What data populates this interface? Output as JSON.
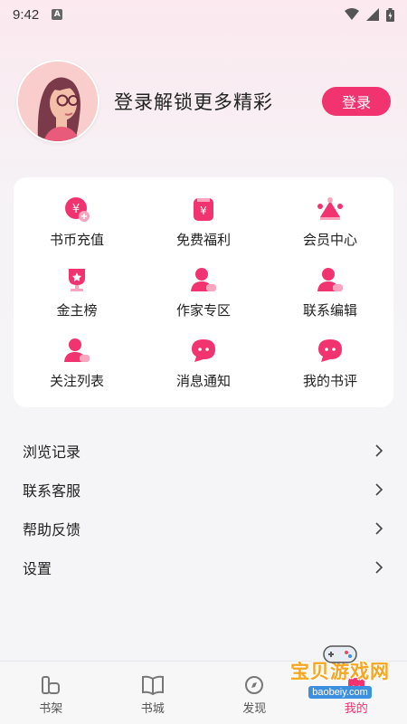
{
  "status_bar": {
    "time": "9:42",
    "notification_letter": "A"
  },
  "profile": {
    "login_prompt": "登录解锁更多精彩",
    "login_button": "登录"
  },
  "grid": [
    {
      "label": "书币充值",
      "icon": "coin-icon"
    },
    {
      "label": "免费福利",
      "icon": "gift-icon"
    },
    {
      "label": "会员中心",
      "icon": "crown-icon"
    },
    {
      "label": "金主榜",
      "icon": "trophy-icon"
    },
    {
      "label": "作家专区",
      "icon": "writer-icon"
    },
    {
      "label": "联系编辑",
      "icon": "editor-icon"
    },
    {
      "label": "关注列表",
      "icon": "follow-icon"
    },
    {
      "label": "消息通知",
      "icon": "message-icon"
    },
    {
      "label": "我的书评",
      "icon": "review-icon"
    }
  ],
  "menu": [
    {
      "label": "浏览记录"
    },
    {
      "label": "联系客服"
    },
    {
      "label": "帮助反馈"
    },
    {
      "label": "设置"
    }
  ],
  "tabs": [
    {
      "label": "书架"
    },
    {
      "label": "书城"
    },
    {
      "label": "发现"
    },
    {
      "label": "我的"
    }
  ],
  "watermark": {
    "title": "宝贝游戏网",
    "url": "baobeiy.com"
  },
  "colors": {
    "accent": "#f1336f",
    "background": "#f5f5f7",
    "card": "#ffffff"
  }
}
